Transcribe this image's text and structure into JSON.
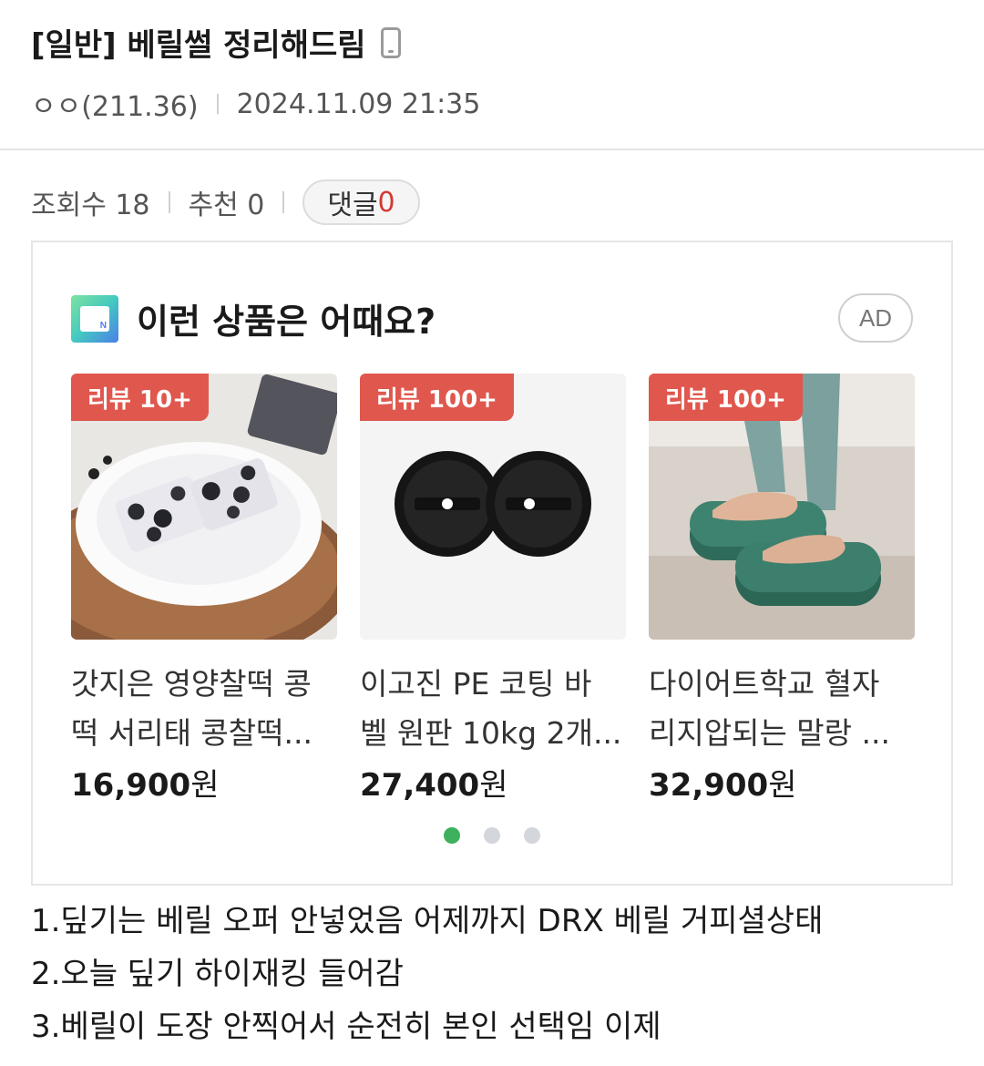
{
  "post": {
    "title": "[일반] 베릴썰 정리해드림",
    "author": "ㅇㅇ(211.36)",
    "datetime": "2024.11.09 21:35",
    "mobile_icon": "mobile-phone-icon"
  },
  "stats": {
    "views": "조회수 18",
    "recommend": "추천 0",
    "comment_label": "댓글",
    "comment_count": "0"
  },
  "ad": {
    "heading": "이런 상품은 어때요?",
    "badge": "AD",
    "logo_icon": "shopping-bag-logo-icon",
    "products": [
      {
        "badge": "리뷰 10+",
        "name_line1": "갓지은 영양찰떡 콩",
        "name_line2": "떡 서리태 콩찰떡...",
        "price": "16,900",
        "unit": "원"
      },
      {
        "badge": "리뷰 100+",
        "name_line1": "이고진 PE 코팅 바",
        "name_line2": "벨 원판 10kg 2개...",
        "price": "27,400",
        "unit": "원"
      },
      {
        "badge": "리뷰 100+",
        "name_line1": "다이어트학교 혈자",
        "name_line2": "리지압되는 말랑 ...",
        "price": "32,900",
        "unit": "원"
      }
    ],
    "pagination": {
      "total": 3,
      "active": 1
    }
  },
  "body": {
    "lines": [
      "1.딮기는 베릴 오퍼 안넣었음 어제까지 DRX 베릴 거피셜상태",
      "2.오늘 딮기 하이재킹 들어감",
      "3.베릴이 도장 안찍어서 순전히 본인 선택임 이제"
    ]
  },
  "colors": {
    "accent_red": "#e0574d",
    "comment_count": "#d23a32",
    "active_dot": "#3fb15d"
  }
}
